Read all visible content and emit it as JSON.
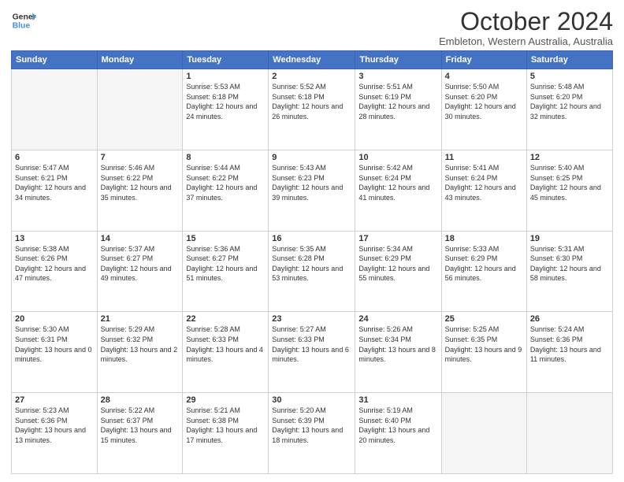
{
  "logo": {
    "line1": "General",
    "line2": "Blue"
  },
  "header": {
    "title": "October 2024",
    "subtitle": "Embleton, Western Australia, Australia"
  },
  "days_of_week": [
    "Sunday",
    "Monday",
    "Tuesday",
    "Wednesday",
    "Thursday",
    "Friday",
    "Saturday"
  ],
  "weeks": [
    [
      {
        "day": "",
        "info": ""
      },
      {
        "day": "",
        "info": ""
      },
      {
        "day": "1",
        "info": "Sunrise: 5:53 AM\nSunset: 6:18 PM\nDaylight: 12 hours and 24 minutes."
      },
      {
        "day": "2",
        "info": "Sunrise: 5:52 AM\nSunset: 6:18 PM\nDaylight: 12 hours and 26 minutes."
      },
      {
        "day": "3",
        "info": "Sunrise: 5:51 AM\nSunset: 6:19 PM\nDaylight: 12 hours and 28 minutes."
      },
      {
        "day": "4",
        "info": "Sunrise: 5:50 AM\nSunset: 6:20 PM\nDaylight: 12 hours and 30 minutes."
      },
      {
        "day": "5",
        "info": "Sunrise: 5:48 AM\nSunset: 6:20 PM\nDaylight: 12 hours and 32 minutes."
      }
    ],
    [
      {
        "day": "6",
        "info": "Sunrise: 5:47 AM\nSunset: 6:21 PM\nDaylight: 12 hours and 34 minutes."
      },
      {
        "day": "7",
        "info": "Sunrise: 5:46 AM\nSunset: 6:22 PM\nDaylight: 12 hours and 35 minutes."
      },
      {
        "day": "8",
        "info": "Sunrise: 5:44 AM\nSunset: 6:22 PM\nDaylight: 12 hours and 37 minutes."
      },
      {
        "day": "9",
        "info": "Sunrise: 5:43 AM\nSunset: 6:23 PM\nDaylight: 12 hours and 39 minutes."
      },
      {
        "day": "10",
        "info": "Sunrise: 5:42 AM\nSunset: 6:24 PM\nDaylight: 12 hours and 41 minutes."
      },
      {
        "day": "11",
        "info": "Sunrise: 5:41 AM\nSunset: 6:24 PM\nDaylight: 12 hours and 43 minutes."
      },
      {
        "day": "12",
        "info": "Sunrise: 5:40 AM\nSunset: 6:25 PM\nDaylight: 12 hours and 45 minutes."
      }
    ],
    [
      {
        "day": "13",
        "info": "Sunrise: 5:38 AM\nSunset: 6:26 PM\nDaylight: 12 hours and 47 minutes."
      },
      {
        "day": "14",
        "info": "Sunrise: 5:37 AM\nSunset: 6:27 PM\nDaylight: 12 hours and 49 minutes."
      },
      {
        "day": "15",
        "info": "Sunrise: 5:36 AM\nSunset: 6:27 PM\nDaylight: 12 hours and 51 minutes."
      },
      {
        "day": "16",
        "info": "Sunrise: 5:35 AM\nSunset: 6:28 PM\nDaylight: 12 hours and 53 minutes."
      },
      {
        "day": "17",
        "info": "Sunrise: 5:34 AM\nSunset: 6:29 PM\nDaylight: 12 hours and 55 minutes."
      },
      {
        "day": "18",
        "info": "Sunrise: 5:33 AM\nSunset: 6:29 PM\nDaylight: 12 hours and 56 minutes."
      },
      {
        "day": "19",
        "info": "Sunrise: 5:31 AM\nSunset: 6:30 PM\nDaylight: 12 hours and 58 minutes."
      }
    ],
    [
      {
        "day": "20",
        "info": "Sunrise: 5:30 AM\nSunset: 6:31 PM\nDaylight: 13 hours and 0 minutes."
      },
      {
        "day": "21",
        "info": "Sunrise: 5:29 AM\nSunset: 6:32 PM\nDaylight: 13 hours and 2 minutes."
      },
      {
        "day": "22",
        "info": "Sunrise: 5:28 AM\nSunset: 6:33 PM\nDaylight: 13 hours and 4 minutes."
      },
      {
        "day": "23",
        "info": "Sunrise: 5:27 AM\nSunset: 6:33 PM\nDaylight: 13 hours and 6 minutes."
      },
      {
        "day": "24",
        "info": "Sunrise: 5:26 AM\nSunset: 6:34 PM\nDaylight: 13 hours and 8 minutes."
      },
      {
        "day": "25",
        "info": "Sunrise: 5:25 AM\nSunset: 6:35 PM\nDaylight: 13 hours and 9 minutes."
      },
      {
        "day": "26",
        "info": "Sunrise: 5:24 AM\nSunset: 6:36 PM\nDaylight: 13 hours and 11 minutes."
      }
    ],
    [
      {
        "day": "27",
        "info": "Sunrise: 5:23 AM\nSunset: 6:36 PM\nDaylight: 13 hours and 13 minutes."
      },
      {
        "day": "28",
        "info": "Sunrise: 5:22 AM\nSunset: 6:37 PM\nDaylight: 13 hours and 15 minutes."
      },
      {
        "day": "29",
        "info": "Sunrise: 5:21 AM\nSunset: 6:38 PM\nDaylight: 13 hours and 17 minutes."
      },
      {
        "day": "30",
        "info": "Sunrise: 5:20 AM\nSunset: 6:39 PM\nDaylight: 13 hours and 18 minutes."
      },
      {
        "day": "31",
        "info": "Sunrise: 5:19 AM\nSunset: 6:40 PM\nDaylight: 13 hours and 20 minutes."
      },
      {
        "day": "",
        "info": ""
      },
      {
        "day": "",
        "info": ""
      }
    ]
  ]
}
